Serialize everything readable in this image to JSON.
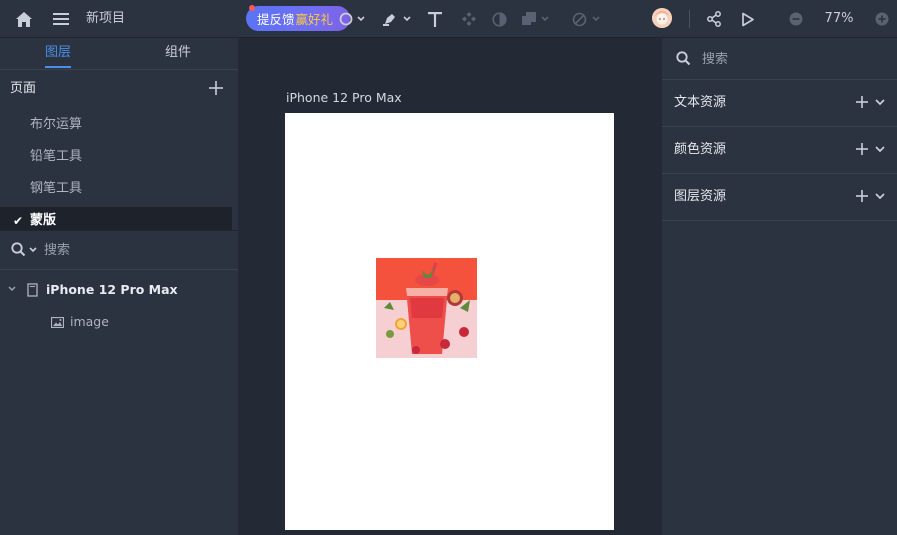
{
  "topbar": {
    "project_name": "新项目",
    "feedback_label": "提反馈",
    "feedback_gift": "赢好礼",
    "zoom_value": "77%"
  },
  "left_panel": {
    "tabs": [
      {
        "label": "图层",
        "active": true
      },
      {
        "label": "组件",
        "active": false
      }
    ],
    "pages_title": "页面",
    "pages": [
      {
        "label": "布尔运算",
        "selected": false
      },
      {
        "label": "铅笔工具",
        "selected": false
      },
      {
        "label": "钢笔工具",
        "selected": false
      },
      {
        "label": "蒙版",
        "selected": true
      }
    ],
    "search_placeholder": "搜索",
    "layers": [
      {
        "label": "iPhone 12 Pro Max",
        "type": "frame-icon"
      },
      {
        "label": "image",
        "type": "image-icon"
      }
    ]
  },
  "canvas": {
    "frame_label": "iPhone 12 Pro Max"
  },
  "right_panel": {
    "search_placeholder": "搜索",
    "sections": [
      {
        "title": "文本资源"
      },
      {
        "title": "颜色资源"
      },
      {
        "title": "图层资源"
      }
    ]
  },
  "colors": {
    "accent": "#4a90e8",
    "panel": "#2b3240",
    "canvas": "#242a35",
    "artboard": "#ffffff"
  }
}
